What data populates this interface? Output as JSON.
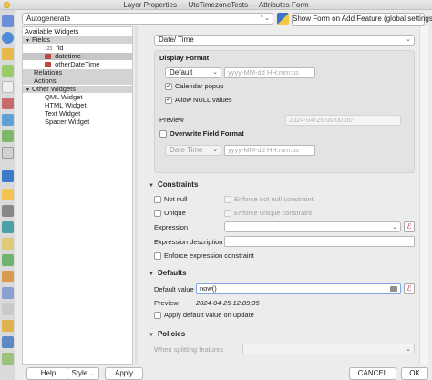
{
  "window": {
    "title": "Layer Properties — UtcTimezoneTests — Attributes Form"
  },
  "toolbar": {
    "layout_value": "Autogenerate",
    "python_icon": "python-icon",
    "show_form_label": "Show Form on Add Feature (global settings)"
  },
  "tree": {
    "header": "Available Widgets",
    "fields_label": "Fields",
    "fields": [
      {
        "label": "fid",
        "type_icon": "123"
      },
      {
        "label": "datetime",
        "type_icon": "calendar-icon"
      },
      {
        "label": "otherDateTime",
        "type_icon": "calendar-icon"
      }
    ],
    "relations_label": "Relations",
    "actions_label": "Actions",
    "other_label": "Other Widgets",
    "other_items": [
      "QML Widget",
      "HTML Widget",
      "Text Widget",
      "Spacer Widget"
    ]
  },
  "widget": {
    "type_value": "Date/ Time",
    "display_format_title": "Display Format",
    "format_value": "Default",
    "format_placeholder": "yyyy-MM-dd HH:mm:ss",
    "calendar_popup_label": "Calendar popup",
    "calendar_popup_checked": true,
    "allow_null_label": "Allow NULL values",
    "allow_null_checked": true,
    "preview_label": "Preview",
    "preview_value": "2024-04-25 00:00:00",
    "overwrite_label": "Overwrite Field Format",
    "overwrite_checked": false,
    "field_format_value": "Date Time",
    "field_format_placeholder": "yyyy-MM-dd HH:mm:ss"
  },
  "constraints": {
    "title": "Constraints",
    "not_null_label": "Not null",
    "enforce_not_null_label": "Enforce not null constraint",
    "unique_label": "Unique",
    "enforce_unique_label": "Enforce unique constraint",
    "expression_label": "Expression",
    "expression_value": "",
    "expression_description_label": "Expression description",
    "expression_description_value": "",
    "enforce_expression_label": "Enforce expression constraint"
  },
  "defaults": {
    "title": "Defaults",
    "default_value_label": "Default value",
    "default_value": "now()",
    "preview_label": "Preview",
    "preview_value": "2024-04-25 12:09:35",
    "apply_update_label": "Apply default value on update"
  },
  "policies": {
    "title": "Policies",
    "splitting_label": "When splitting features"
  },
  "buttons": {
    "help": "Help",
    "style": "Style",
    "apply": "Apply",
    "cancel": "CANCEL",
    "ok": "OK"
  },
  "colors": {
    "accent": "#3b73c7",
    "expression_epsilon": "#b7222e"
  }
}
